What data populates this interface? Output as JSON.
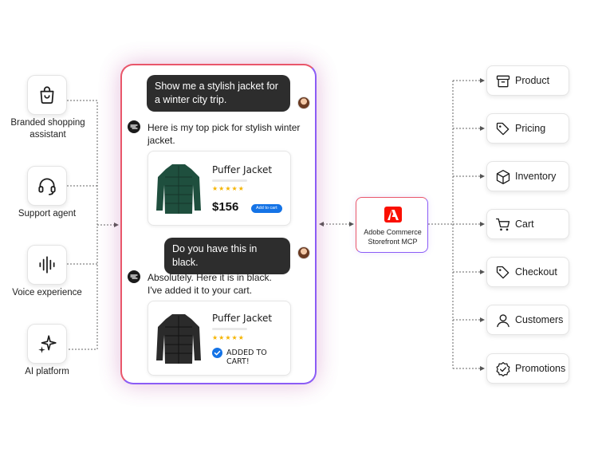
{
  "agents": [
    {
      "label": "Branded shopping\nassistant",
      "icon": "shopping-bag-icon"
    },
    {
      "label": "Support agent",
      "icon": "headset-icon"
    },
    {
      "label": "Voice experience",
      "icon": "waveform-icon"
    },
    {
      "label": "AI platform",
      "icon": "sparkle-icon"
    }
  ],
  "chat": {
    "user_message_1": "Show me a stylish jacket for a winter city trip.",
    "bot_message_1": "Here is my top pick for stylish winter jacket.",
    "product_1": {
      "name": "Puffer Jacket",
      "stars": "★★★★★",
      "price": "$156",
      "button": "Add to cart",
      "color": "#1f4f3e"
    },
    "user_message_2": "Do you have this in black.",
    "bot_message_2": "Absolutely. Here it is in black.\nI've added it to your cart.",
    "product_2": {
      "name": "Puffer Jacket",
      "stars": "★★★★★",
      "status": "ADDED TO CART!",
      "color": "#2b2b2b"
    }
  },
  "mcp": {
    "label": "Adobe Commerce\nStorefront MCP",
    "icon": "adobe-logo-icon",
    "brand_color": "#fa0f00"
  },
  "services": [
    {
      "label": "Product",
      "icon": "archive-box-icon"
    },
    {
      "label": "Pricing",
      "icon": "price-tag-icon"
    },
    {
      "label": "Inventory",
      "icon": "package-icon"
    },
    {
      "label": "Cart",
      "icon": "cart-icon"
    },
    {
      "label": "Checkout",
      "icon": "tag-icon"
    },
    {
      "label": "Customers",
      "icon": "user-icon"
    },
    {
      "label": "Promotions",
      "icon": "badge-check-icon"
    }
  ],
  "colors": {
    "accent_red": "#e9566a",
    "accent_purple": "#8b5cf6",
    "button_blue": "#1473e6",
    "star": "#f5b400"
  }
}
